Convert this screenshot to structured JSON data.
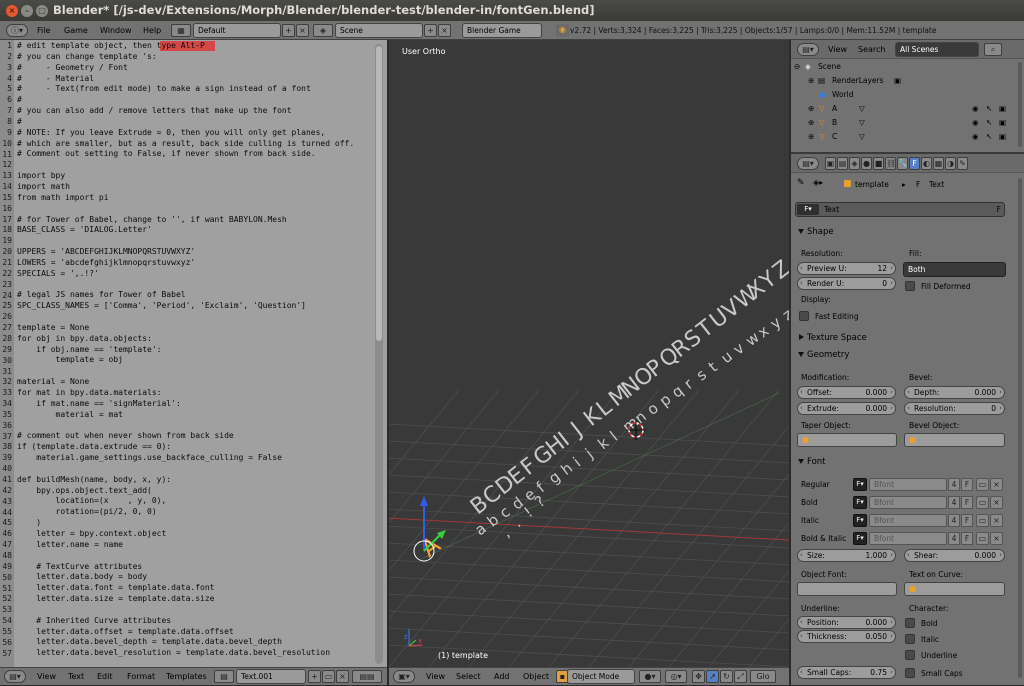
{
  "window": {
    "title": "Blender* [/js-dev/Extensions/Morph/Blender/blender-test/blender-in/fontGen.blend]"
  },
  "info": {
    "menus": [
      "File",
      "Game",
      "Window",
      "Help"
    ],
    "screen_layout": "Default",
    "scene": "Scene",
    "engine": "Blender Game",
    "stats": "v2.72 | Verts:3,324 | Faces:3,225 | Tris:3,225 | Objects:1/57 | Lamps:0/0 | Mem:11.52M | template"
  },
  "text_editor": {
    "line_numbers": [
      "1",
      "2",
      "3",
      "4",
      "5",
      "6",
      "7",
      "8",
      "9",
      "10",
      "11",
      "12",
      "13",
      "14",
      "15",
      "16",
      "17",
      "18",
      "19",
      "20",
      "21",
      "22",
      "23",
      "24",
      "25",
      "26",
      "27",
      "28",
      "29",
      "30",
      "31",
      "32",
      "33",
      "34",
      "35",
      "36",
      "37",
      "38",
      "39",
      "40",
      "41",
      "42",
      "43",
      "44",
      "45",
      "46",
      "47",
      "48",
      "49",
      "50",
      "51",
      "52",
      "53",
      "54",
      "55",
      "56",
      "57"
    ],
    "code": "# edit template object, then type Alt-P\n# you can change template 's:\n#     - Geometry / Font\n#     - Material\n#     - Text(from edit mode) to make a sign instead of a font\n#\n# you can also add / remove letters that make up the font\n#\n# NOTE: If you leave Extrude = 0, then you will only get planes,\n# which are smaller, but as a result, back side culling is turned off.\n# Comment out setting to False, if never shown from back side.\n\nimport bpy\nimport math\nfrom math import pi\n\n# for Tower of Babel, change to '', if want BABYLON.Mesh\nBASE_CLASS = 'DIALOG.Letter'\n\nUPPERS = 'ABCDEFGHIJKLMNOPQRSTUVWXYZ'\nLOWERS = 'abcdefghijklmnopqrstuvwxyz'\nSPECIALS = ',.!?'\n\n# legal JS names for Tower of Babel\nSPC_CLASS_NAMES = ['Comma', 'Period', 'Exclaim', 'Question']\n\ntemplate = None\nfor obj in bpy.data.objects:\n    if obj.name == 'template':\n        template = obj\n\nmaterial = None\nfor mat in bpy.data.materials:\n    if mat.name == 'signMaterial':\n        material = mat\n\n# comment out when never shown from back side\nif (template.data.extrude == 0):\n    material.game_settings.use_backface_culling = False\n\ndef buildMesh(name, body, x, y):\n    bpy.ops.object.text_add(\n        location=(x    , y, 0),\n        rotation=(pi/2, 0, 0)\n    )\n    letter = bpy.context.object\n    letter.name = name\n\n    # TextCurve attributes\n    letter.data.body = body\n    letter.data.font = template.data.font\n    letter.data.size = template.data.size\n\n    # Inherited Curve attributes\n    letter.data.offset = template.data.offset\n    letter.data.bevel_depth = template.data.bevel_depth\n    letter.data.bevel_resolution = template.data.bevel_resolution",
    "footer_menus": [
      "View",
      "Text",
      "Edit",
      "Format",
      "Templates"
    ],
    "datablock": "Text.001"
  },
  "viewport": {
    "label": "User Ortho",
    "object_label": "(1) template",
    "uppers": "ABCDEFGHIJKLMNOPQRSTUVWXYZ",
    "lowers": "abcdefghijklmnopqrstuvwxyz",
    "specials": ",.!?",
    "footer_menus": [
      "View",
      "Select",
      "Add",
      "Object"
    ],
    "mode": "Object Mode",
    "glob": "Glo"
  },
  "outliner": {
    "menus": [
      "View",
      "Search"
    ],
    "filter": "All Scenes",
    "items": [
      {
        "label": "Scene"
      },
      {
        "label": "RenderLayers"
      },
      {
        "label": "World"
      },
      {
        "label": "A"
      },
      {
        "label": "B"
      },
      {
        "label": "C"
      }
    ]
  },
  "properties": {
    "breadcrumb": {
      "object": "template",
      "data": "Text"
    },
    "datablock": "Text",
    "datablock_suffix": "F",
    "shape": {
      "title": "Shape",
      "resolution_label": "Resolution:",
      "preview_u_label": "Preview U:",
      "preview_u": "12",
      "render_u_label": "Render U:",
      "render_u": "0",
      "fill_label": "Fill:",
      "fill": "Both",
      "fill_deformed": "Fill Deformed",
      "display_label": "Display:",
      "fast_editing": "Fast Editing"
    },
    "texture_space": {
      "title": "Texture Space"
    },
    "geometry": {
      "title": "Geometry",
      "modification_label": "Modification:",
      "offset_label": "Offset:",
      "offset": "0.000",
      "extrude_label": "Extrude:",
      "extrude": "0.000",
      "bevel_label": "Bevel:",
      "depth_label": "Depth:",
      "depth": "0.000",
      "resolution_label": "Resolution:",
      "resolution": "0",
      "taper_label": "Taper Object:",
      "bevel_object_label": "Bevel Object:"
    },
    "font": {
      "title": "Font",
      "rows": [
        {
          "label": "Regular",
          "font": "Bfont",
          "users": "4",
          "f": "F"
        },
        {
          "label": "Bold",
          "font": "Bfont",
          "users": "4",
          "f": "F"
        },
        {
          "label": "Italic",
          "font": "Bfont",
          "users": "4",
          "f": "F"
        },
        {
          "label": "Bold & Italic",
          "font": "Bfont",
          "users": "4",
          "f": "F"
        }
      ],
      "size_label": "Size:",
      "size": "1.000",
      "shear_label": "Shear:",
      "shear": "0.000",
      "object_font_label": "Object Font:",
      "text_on_curve_label": "Text on Curve:",
      "underline_label": "Underline:",
      "position_label": "Position:",
      "position": "0.000",
      "thickness_label": "Thickness:",
      "thickness": "0.050",
      "character_label": "Character:",
      "bold": "Bold",
      "italic": "Italic",
      "underline": "Underline",
      "small_caps_label": "Small Caps:",
      "small_caps_value": "0.75",
      "small_caps": "Small Caps"
    }
  },
  "colors": {
    "accent_blue": "#5680c2",
    "selected_orange": "#f1a03a",
    "highlight_red": "#ff0000"
  }
}
